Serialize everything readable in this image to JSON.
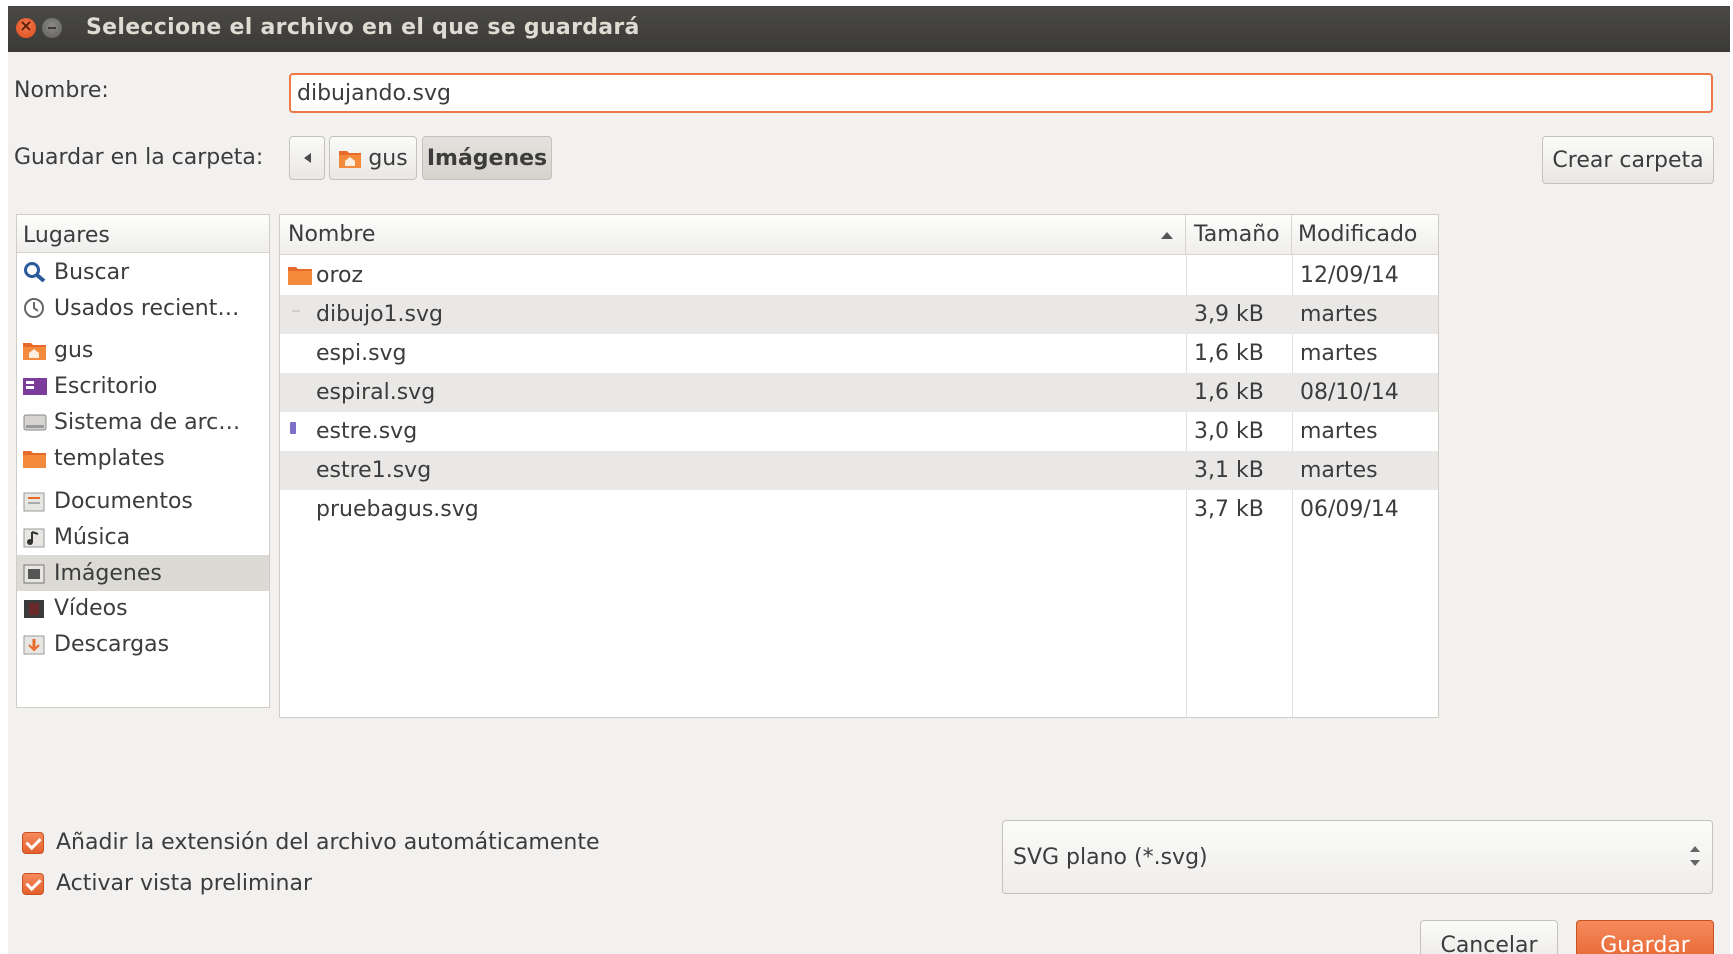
{
  "window": {
    "title": "Seleccione el archivo en el que se guardará"
  },
  "name_field": {
    "label": "Nombre:",
    "value": "dibujando.svg"
  },
  "folder": {
    "label": "Guardar en la carpeta:",
    "breadcrumbs": [
      "gus",
      "Imágenes"
    ],
    "create_button": "Crear carpeta"
  },
  "places": {
    "header": "Lugares",
    "items": [
      {
        "label": "Buscar",
        "icon": "search-icon"
      },
      {
        "label": "Usados recient…",
        "icon": "recent-icon"
      },
      {
        "label": "gus",
        "icon": "home-folder-icon"
      },
      {
        "label": "Escritorio",
        "icon": "desktop-icon"
      },
      {
        "label": "Sistema de arc…",
        "icon": "drive-icon"
      },
      {
        "label": "templates",
        "icon": "folder-icon"
      },
      {
        "label": "Documentos",
        "icon": "documents-icon"
      },
      {
        "label": "Música",
        "icon": "music-icon"
      },
      {
        "label": "Imágenes",
        "icon": "pictures-icon",
        "selected": true
      },
      {
        "label": "Vídeos",
        "icon": "videos-icon"
      },
      {
        "label": "Descargas",
        "icon": "downloads-icon"
      }
    ]
  },
  "files": {
    "columns": [
      "Nombre",
      "Tamaño",
      "Modificado"
    ],
    "sort_column": "Nombre",
    "rows": [
      {
        "name": "oroz",
        "size": "",
        "modified": "12/09/14",
        "icon": "folder-icon"
      },
      {
        "name": "dibujo1.svg",
        "size": "3,9 kB",
        "modified": "martes",
        "icon": "svg-file-icon"
      },
      {
        "name": "espi.svg",
        "size": "1,6 kB",
        "modified": "martes",
        "icon": "svg-file-icon"
      },
      {
        "name": "espiral.svg",
        "size": "1,6 kB",
        "modified": "08/10/14",
        "icon": "svg-file-icon"
      },
      {
        "name": "estre.svg",
        "size": "3,0 kB",
        "modified": "martes",
        "icon": "svg-file-icon"
      },
      {
        "name": "estre1.svg",
        "size": "3,1 kB",
        "modified": "martes",
        "icon": "svg-file-icon"
      },
      {
        "name": "pruebagus.svg",
        "size": "3,7 kB",
        "modified": "06/09/14",
        "icon": "svg-file-icon"
      }
    ]
  },
  "options": {
    "auto_extension": {
      "label": "Añadir la extensión del archivo automáticamente",
      "checked": true
    },
    "preview": {
      "label": "Activar vista preliminar",
      "checked": true
    }
  },
  "filter": {
    "value": "SVG plano (*.svg)"
  },
  "buttons": {
    "cancel": "Cancelar",
    "save": "Guardar"
  },
  "colors": {
    "accent": "#e4602c",
    "titlebar": "#3b3a36",
    "selection": "#dcdad5"
  }
}
